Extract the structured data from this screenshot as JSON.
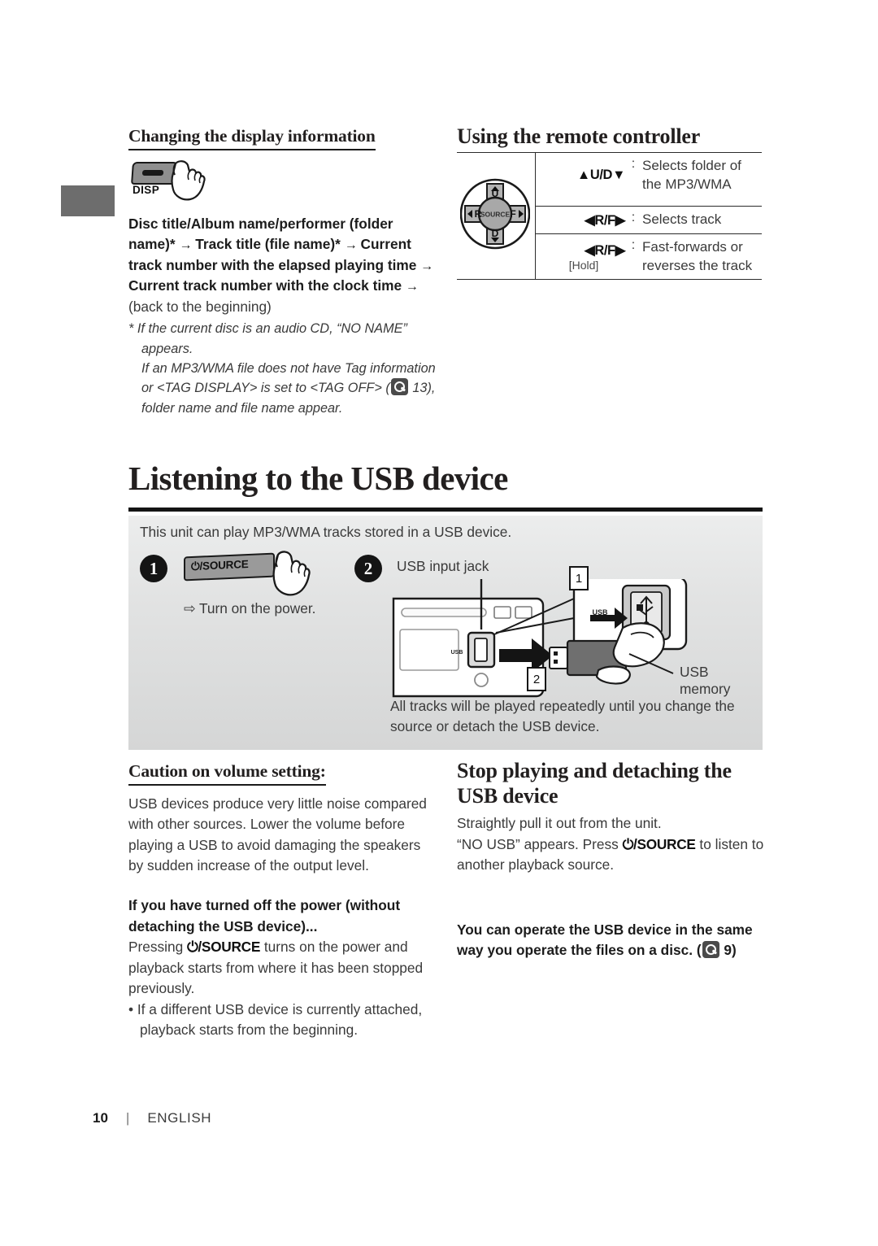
{
  "page": {
    "number": "10",
    "separator": "|",
    "language": "ENGLISH"
  },
  "left_column": {
    "heading": "Changing the display information",
    "button_icon_label": "DISP",
    "sequence_bold_1": "Disc title/Album name/performer (folder name)*",
    "arrow": "→",
    "sequence_bold_2": "Track title (file name)*",
    "sequence_bold_3": "Current track number with the elapsed playing time",
    "sequence_bold_4": "Current track number with the clock time",
    "sequence_tail": "(back to the beginning)",
    "footnote_marker": "*",
    "footnote_line_1": "If the current disc is an audio CD, “NO NAME” appears.",
    "footnote_line_2": "If an MP3/WMA file does not have Tag information or <TAG DISPLAY> is set to <TAG OFF> (",
    "footnote_page_ref": "13",
    "footnote_line_3": "), folder name and file name appear."
  },
  "remote": {
    "heading": "Using the remote controller",
    "pad": {
      "center_label": "SOURCE",
      "up_label": "U",
      "down_label": "D",
      "left_label": "R",
      "right_label": "F"
    },
    "rows": [
      {
        "key": "▲U/D▼",
        "colon": ":",
        "description": "Selects folder of the MP3/WMA",
        "hold": ""
      },
      {
        "key": "◀R/F▶",
        "colon": ":",
        "description": "Selects track",
        "hold": ""
      },
      {
        "key": "◀R/F▶",
        "colon": ":",
        "description": "Fast-forwards or reverses the track",
        "hold": "[Hold]"
      }
    ]
  },
  "usb_section": {
    "title": "Listening to the USB device",
    "intro": "This unit can play MP3/WMA tracks stored in a USB device.",
    "step1": {
      "badge": "1",
      "button_label": "⏻/SOURCE",
      "result_arrow": "⇨",
      "result": "Turn on the power."
    },
    "step2": {
      "badge": "2",
      "jack_label": "USB input jack",
      "memory_label": "USB memory",
      "callout_1": "1",
      "callout_2": "2",
      "port_label": "USB"
    },
    "footnote": "All tracks will be played repeatedly until you change the source or detach the USB device."
  },
  "caution": {
    "heading": "Caution on volume setting:",
    "body": "USB devices produce very little noise compared with other sources. Lower the volume before playing a USB to avoid damaging the speakers by sudden increase of the output level.",
    "subheading": "If you have turned off the power (without detaching the USB device)...",
    "body2_pre": "Pressing ",
    "body2_key": "⏻/SOURCE",
    "body2_post": " turns on the power and playback starts from where it has been stopped previously.",
    "bullet": "• If a different USB device is currently attached, playback starts from the beginning."
  },
  "stop_section": {
    "heading": "Stop playing and detaching the USB device",
    "line1": "Straightly pull it out from the unit.",
    "line2_pre": "“NO USB” appears. Press ",
    "line2_key": "⏻/SOURCE",
    "line2_post": " to listen to another playback source.",
    "note_pre": "You can operate the USB device in the same way you operate the files on a disc.  (",
    "note_page_ref": "9",
    "note_post": ")"
  },
  "colors": {
    "rule": "#141414",
    "panel_bg": "#e4e5e5",
    "tab": "#6d6d6d",
    "text": "#3a3a3a"
  }
}
